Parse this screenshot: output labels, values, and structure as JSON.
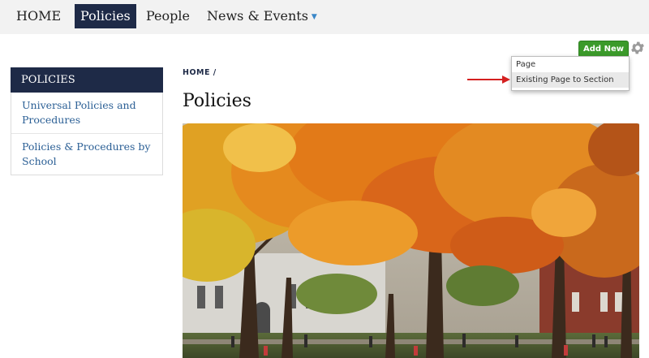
{
  "topnav": {
    "items": [
      {
        "label": "HOME"
      },
      {
        "label": "Policies",
        "active": true
      },
      {
        "label": "People"
      },
      {
        "label": "News & Events",
        "caret": "chevron-down-icon"
      }
    ]
  },
  "admin": {
    "add_new_label": "Add New",
    "settings_icon": "gear-icon",
    "dropdown": {
      "items": [
        {
          "label": "Page"
        },
        {
          "label": "Existing Page to Section"
        }
      ],
      "highlighted_index": 1
    },
    "annotation_arrow_color": "#d42020"
  },
  "sidebar": {
    "title": "POLICIES",
    "items": [
      {
        "label": "Universal Policies and Procedures"
      },
      {
        "label": "Policies & Procedures by School"
      }
    ]
  },
  "breadcrumb": {
    "home": "HOME",
    "separator": "/"
  },
  "page": {
    "title": "Policies"
  },
  "colors": {
    "brand_navy": "#1e2a47",
    "link_blue": "#2b5f95",
    "add_new_green": "#3b9a2a",
    "nav_bg": "#f2f2f2"
  }
}
